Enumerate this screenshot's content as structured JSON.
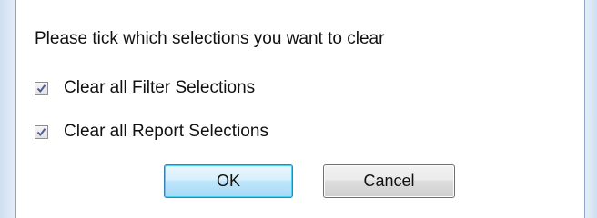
{
  "dialog": {
    "prompt": "Please tick which selections you want to clear",
    "options": [
      {
        "label": "Clear all Filter Selections",
        "checked": true
      },
      {
        "label": "Clear all Report Selections",
        "checked": true
      }
    ],
    "buttons": {
      "ok_label": "OK",
      "cancel_label": "Cancel"
    }
  },
  "colors": {
    "frame": "#dfeaf6",
    "checkmark": "#4a5f97",
    "ok_border": "#3c7fb1"
  }
}
